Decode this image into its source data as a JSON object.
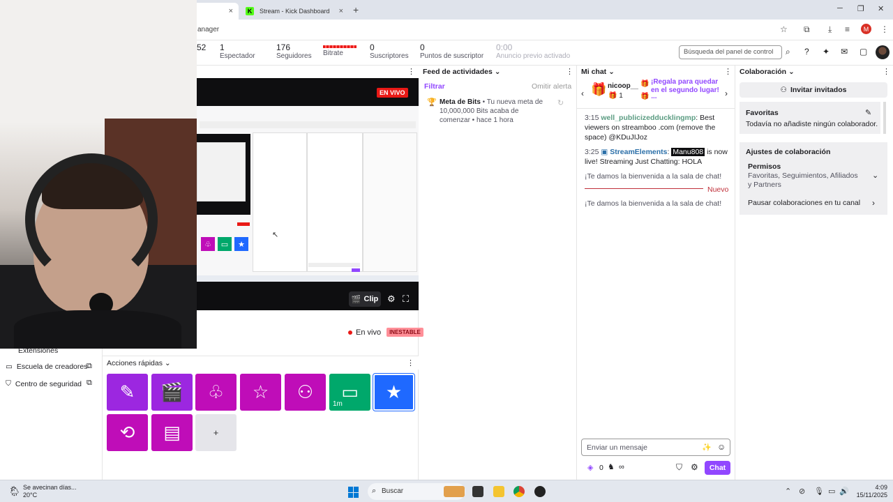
{
  "browser": {
    "tab_inactive_title": "Stream - Kick Dashboard",
    "kick_letter": "K",
    "url_fragment": "anager",
    "profile_initial": "M",
    "tab_close": "×",
    "new_tab": "+",
    "min": "─",
    "max": "❐",
    "close": "✕"
  },
  "stats": {
    "partial": "52",
    "viewers": {
      "num": "1",
      "label": "Espectador"
    },
    "followers": {
      "num": "176",
      "label": "Seguidores"
    },
    "bitrate": {
      "label": "Bitrate"
    },
    "subs": {
      "num": "0",
      "label": "Suscriptores"
    },
    "sub_points": {
      "num": "0",
      "label": "Puntos de suscriptor"
    },
    "ad": {
      "num": "0:00",
      "label": "Anuncio previo activado"
    },
    "search_placeholder": "Búsqueda del panel de control"
  },
  "preview": {
    "live_badge": "EN VIVO",
    "clip_label": "Clip",
    "live_status": "En vivo",
    "unstable": "INESTABLE"
  },
  "leftnav": {
    "items": [
      {
        "label": "Extensiones"
      },
      {
        "label": "Escuela de creadores"
      },
      {
        "label": "Centro de seguridad"
      }
    ]
  },
  "quick_actions": {
    "title": "Acciones rápidas",
    "cooldown": "1m",
    "add": "+"
  },
  "activity": {
    "title": "Feed de actividades",
    "filter": "Filtrar",
    "skip": "Omitir alerta",
    "item_title": "Meta de Bits",
    "item_body": "Tu nueva meta de 10,000,000 Bits acaba de comenzar",
    "item_time": "hace 1 hora"
  },
  "chat": {
    "title": "Mi chat",
    "gift_user": "nicoop__",
    "gift_count": "1",
    "gift_text": "¡Regala para quedar en el segundo lugar!",
    "gift_more": "...",
    "messages": [
      {
        "time": "3:15",
        "user": "well_publicizedducklingmp",
        "text": "Best viewers on streamboo .com (remove the space) @KDuJIJoz"
      },
      {
        "time": "3:25",
        "user": "StreamElements",
        "mention": "Manu808",
        "text": "is now live! Streaming Just Chatting: HOLA"
      }
    ],
    "welcome": "¡Te damos la bienvenida a la sala de chat!",
    "new_label": "Nuevo",
    "input_placeholder": "Enviar un mensaje",
    "points": "0",
    "infinity": "∞",
    "send": "Chat"
  },
  "collab": {
    "title": "Colaboración",
    "invite": "Invitar invitados",
    "favorites_title": "Favoritas",
    "favorites_empty": "Todavía no añadiste ningún colaborador.",
    "settings_title": "Ajustes de colaboración",
    "permissions_title": "Permisos",
    "permissions_desc": "Favoritas, Seguimientos, Afiliados y Partners",
    "pause": "Pausar colaboraciones en tu canal"
  },
  "taskbar": {
    "weather_text": "Se avecinan días...",
    "temp": "20°C",
    "search": "Buscar",
    "time": "4:09",
    "date": "15/11/2025"
  },
  "colors": {
    "accent": "#9147ff",
    "quick_magenta": "#bf0db8",
    "quick_purple": "#9c27e0",
    "quick_green": "#00a86b",
    "quick_blue": "#1f69ff",
    "live_red": "#e91916"
  }
}
